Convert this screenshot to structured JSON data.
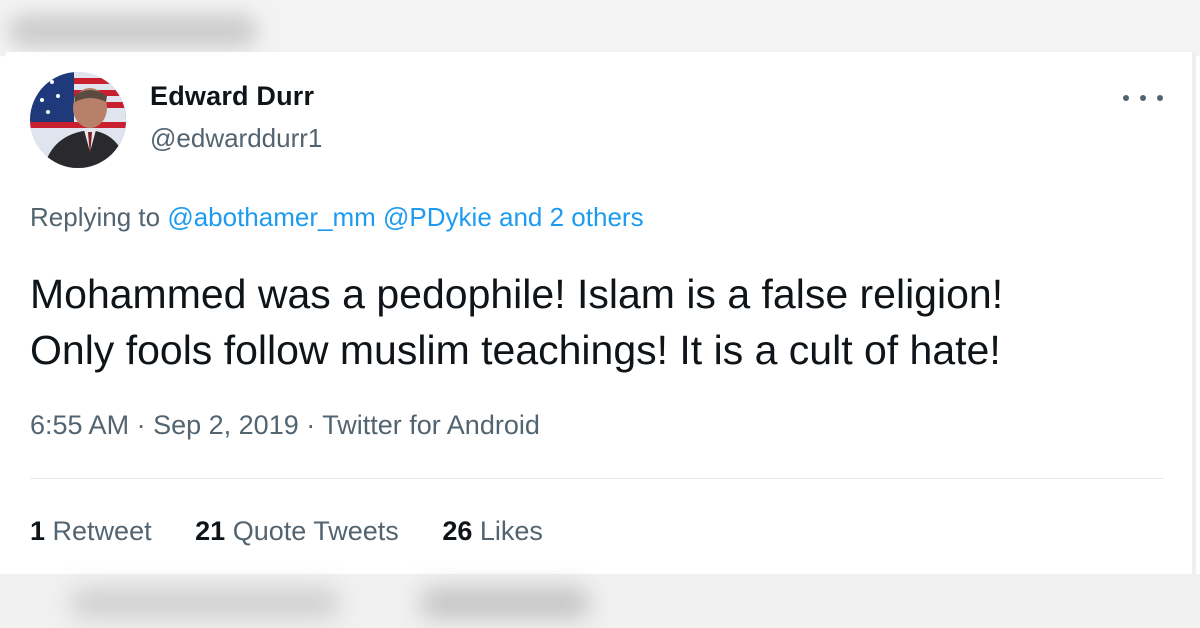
{
  "tweet": {
    "author_name": "Edward Durr",
    "author_handle": "@edwarddurr1",
    "reply": {
      "prefix": "Replying to",
      "mentions": [
        "@abothamer_mm",
        "@PDykie"
      ],
      "others": "and 2 others"
    },
    "text_line1": "Mohammed was a pedophile! Islam is a false religion!",
    "text_line2": "Only fools follow muslim teachings! It is a cult of hate!",
    "time": "6:55 AM",
    "date": "Sep 2, 2019",
    "source": "Twitter for Android",
    "separator": "·",
    "stats": {
      "retweets_count": "1",
      "retweets_label": "Retweet",
      "quotes_count": "21",
      "quotes_label": "Quote Tweets",
      "likes_count": "26",
      "likes_label": "Likes"
    }
  },
  "colors": {
    "text": "#0f1419",
    "secondary": "#536471",
    "link": "#1d9bf0",
    "divider": "#e6ebee"
  },
  "icons": {
    "more": "more-horizontal-icon",
    "avatar": "profile-photo"
  }
}
